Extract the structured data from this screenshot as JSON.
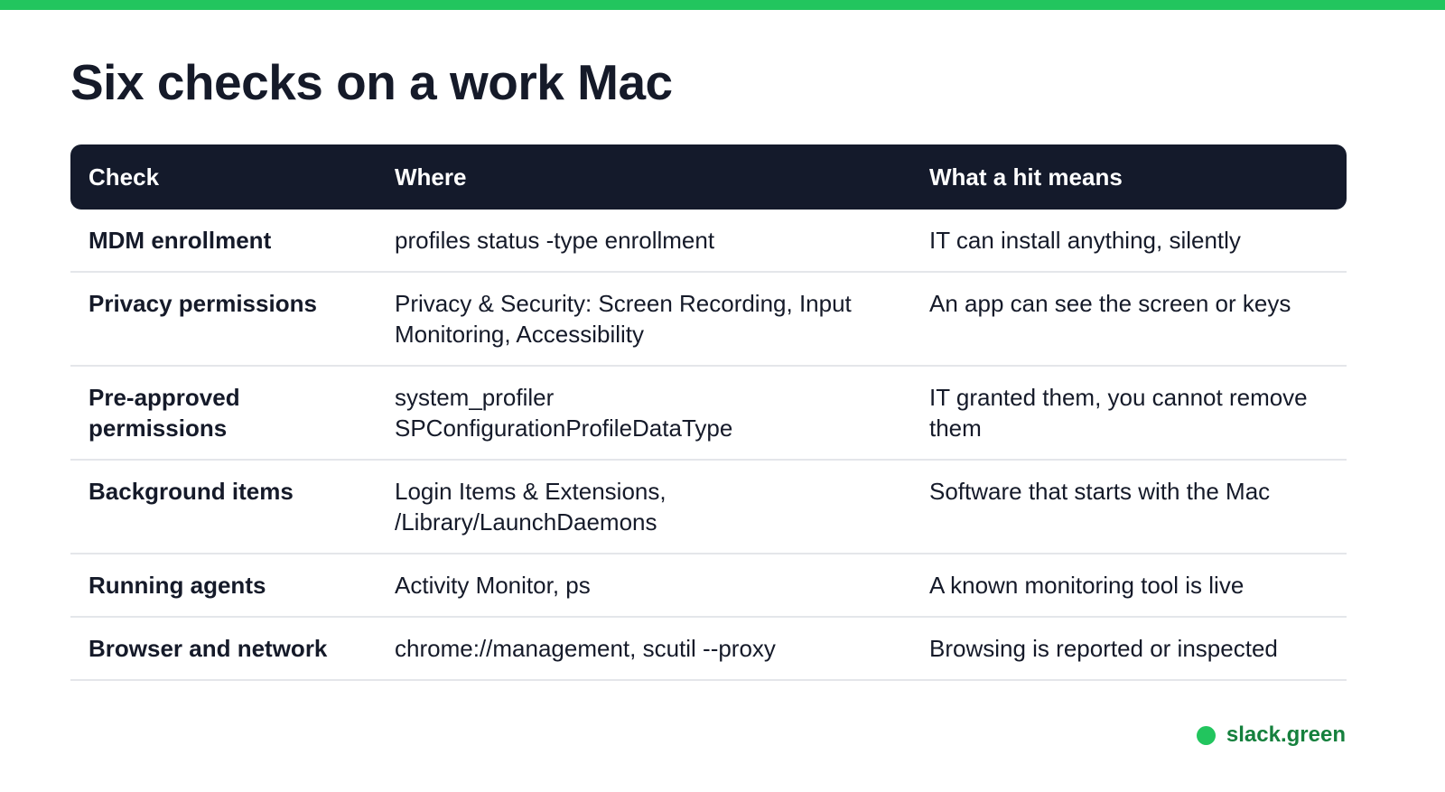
{
  "title": "Six checks on a work Mac",
  "colors": {
    "accent": "#22c55e",
    "header_bg": "#141a2b",
    "text": "#151a29",
    "brand_text": "#15803d"
  },
  "table": {
    "headers": [
      "Check",
      "Where",
      "What a hit means"
    ],
    "rows": [
      {
        "check": "MDM enrollment",
        "where": "profiles status -type enrollment",
        "meaning": "IT can install anything, silently"
      },
      {
        "check": "Privacy permissions",
        "where": "Privacy & Security: Screen Recording, Input Monitoring, Accessibility",
        "meaning": "An app can see the screen or keys"
      },
      {
        "check": "Pre-approved permissions",
        "where": "system_profiler SPConfigurationProfileDataType",
        "meaning": "IT granted them, you cannot remove them"
      },
      {
        "check": "Background items",
        "where": "Login Items & Extensions, /Library/LaunchDaemons",
        "meaning": "Software that starts with the Mac"
      },
      {
        "check": "Running agents",
        "where": "Activity Monitor, ps",
        "meaning": "A known monitoring tool is live"
      },
      {
        "check": "Browser and network",
        "where": "chrome://management, scutil --proxy",
        "meaning": "Browsing is reported or inspected"
      }
    ]
  },
  "brand": {
    "icon": "green-dot-icon",
    "label": "slack.green"
  }
}
